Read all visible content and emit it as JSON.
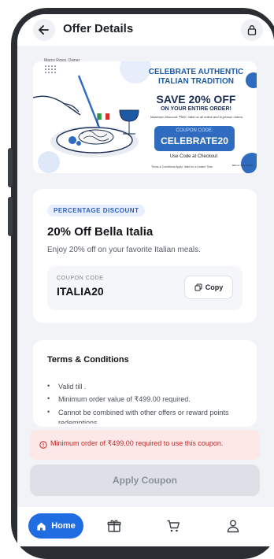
{
  "header": {
    "title": "Offer Details"
  },
  "banner": {
    "owner": "Marco Rossi, Owner",
    "headline": "CELEBRATE AUTHENTIC ITALIAN TRADITION",
    "save": "SAVE 20% OFF",
    "sub": "ON YOUR ENTIRE ORDER!",
    "max_discount": "Maximum Discount: ₹500. Valid on all online and in-person orders.",
    "code_label": "COUPON CODE:",
    "code": "CELEBRATE20",
    "use_code": "Use Code at Checkout",
    "terms": "Terms & Conditions Apply. Valid for a Limited Time.",
    "logo_text": "BELLA VITA ITALIA"
  },
  "offer": {
    "type_badge": "PERCENTAGE DISCOUNT",
    "title": "20% Off Bella Italia",
    "description": "Enjoy 20% off on your favorite Italian meals.",
    "coupon_label": "COUPON CODE",
    "coupon_code": "ITALIA20",
    "copy_label": "Copy"
  },
  "terms": {
    "title": "Terms & Conditions",
    "items": [
      "Valid till .",
      "Minimum order value of ₹499.00 required.",
      "Cannot be combined with other offers or reward points redemptions."
    ]
  },
  "error_message": "Minimum order of ₹499.00 required to use this coupon.",
  "apply_label": "Apply Coupon",
  "nav": {
    "home_label": "Home"
  },
  "colors": {
    "accent": "#1f6de0",
    "error": "#c62828",
    "banner_blue": "#2f6cc0"
  }
}
